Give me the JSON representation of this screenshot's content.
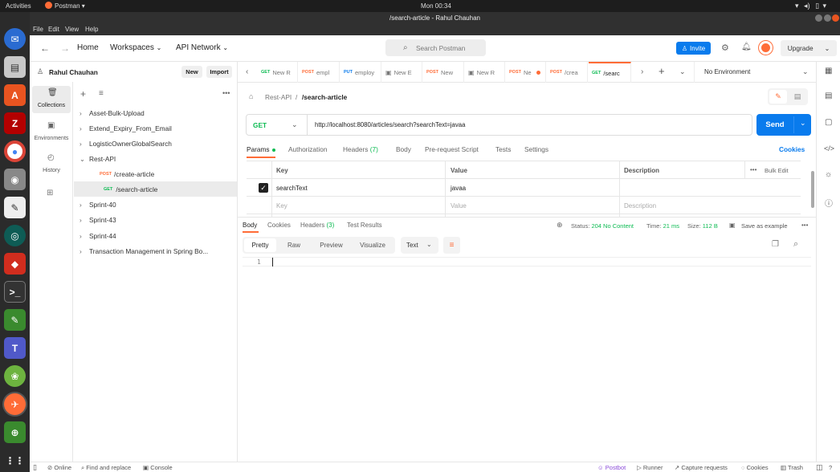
{
  "system": {
    "activities": "Activities",
    "app_name": "Postman",
    "clock": "Mon 00:34"
  },
  "window": {
    "title": "/search-article - Rahul Chauhan",
    "menu": [
      "File",
      "Edit",
      "View",
      "Help"
    ]
  },
  "header": {
    "home": "Home",
    "workspaces": "Workspaces",
    "api_network": "API Network",
    "search_placeholder": "Search Postman",
    "invite": "Invite",
    "upgrade": "Upgrade"
  },
  "sidebar": {
    "user": "Rahul Chauhan",
    "new": "New",
    "import": "Import",
    "rail": [
      {
        "label": "Collections"
      },
      {
        "label": "Environments"
      },
      {
        "label": "History"
      }
    ],
    "tree": [
      {
        "label": "Asset-Bulk-Upload"
      },
      {
        "label": "Extend_Expiry_From_Email"
      },
      {
        "label": "LogisticOwnerGlobalSearch"
      },
      {
        "label": "Rest-API"
      },
      {
        "method": "POST",
        "label": "/create-article"
      },
      {
        "method": "GET",
        "label": "/search-article"
      },
      {
        "label": "Sprint-40"
      },
      {
        "label": "Sprint-43"
      },
      {
        "label": "Sprint-44"
      },
      {
        "label": "Transaction Management in Spring Bo..."
      }
    ]
  },
  "tabs": [
    {
      "method": "GET",
      "label": "New R",
      "color": "#0cbb52"
    },
    {
      "method": "POST",
      "label": "empl",
      "color": "#ff6c37"
    },
    {
      "method": "PUT",
      "label": "employ",
      "color": "#097bed"
    },
    {
      "method": "",
      "label": "New E",
      "color": "#777"
    },
    {
      "method": "POST",
      "label": "New",
      "color": "#ff6c37"
    },
    {
      "method": "",
      "label": "New R",
      "color": "#777"
    },
    {
      "method": "POST",
      "label": "Ne",
      "color": "#ff6c37"
    },
    {
      "method": "POST",
      "label": "/crea",
      "color": "#ff6c37"
    },
    {
      "method": "GET",
      "label": "/searc",
      "color": "#0cbb52"
    }
  ],
  "environment": "No Environment",
  "request": {
    "breadcrumb_parent": "Rest-API",
    "breadcrumb_sep": "/",
    "name": "/search-article",
    "method": "GET",
    "url": "http://localhost:8080/articles/search?searchText=javaa",
    "send": "Send"
  },
  "req_tabs": {
    "params": "Params",
    "authorization": "Authorization",
    "headers_label": "Headers",
    "headers_count": "(7)",
    "body": "Body",
    "prerequest": "Pre-request Script",
    "tests": "Tests",
    "settings": "Settings",
    "cookies": "Cookies"
  },
  "params_table": {
    "headers": [
      "Key",
      "Value",
      "Description"
    ],
    "bulk_edit": "Bulk Edit",
    "rows": [
      {
        "key": "searchText",
        "value": "javaa",
        "checked": true
      }
    ],
    "placeholder": {
      "key": "Key",
      "value": "Value",
      "description": "Description"
    }
  },
  "response": {
    "tabs": {
      "body": "Body",
      "cookies": "Cookies",
      "headers_label": "Headers",
      "headers_count": "(3)",
      "test_results": "Test Results"
    },
    "status_label": "Status:",
    "status": "204 No Content",
    "time_label": "Time:",
    "time": "21 ms",
    "size_label": "Size:",
    "size": "112 B",
    "save_example": "Save as example",
    "views": [
      "Pretty",
      "Raw",
      "Preview",
      "Visualize"
    ],
    "format": "Text",
    "line_number": "1"
  },
  "status_bar": {
    "online": "Online",
    "find_replace": "Find and replace",
    "console": "Console",
    "postbot": "Postbot",
    "runner": "Runner",
    "capture": "Capture requests",
    "cookies": "Cookies",
    "trash": "Trash"
  },
  "colors": {
    "accent": "#ff6c37",
    "primary": "#097bed",
    "get": "#0cbb52",
    "post": "#ff6c37"
  }
}
